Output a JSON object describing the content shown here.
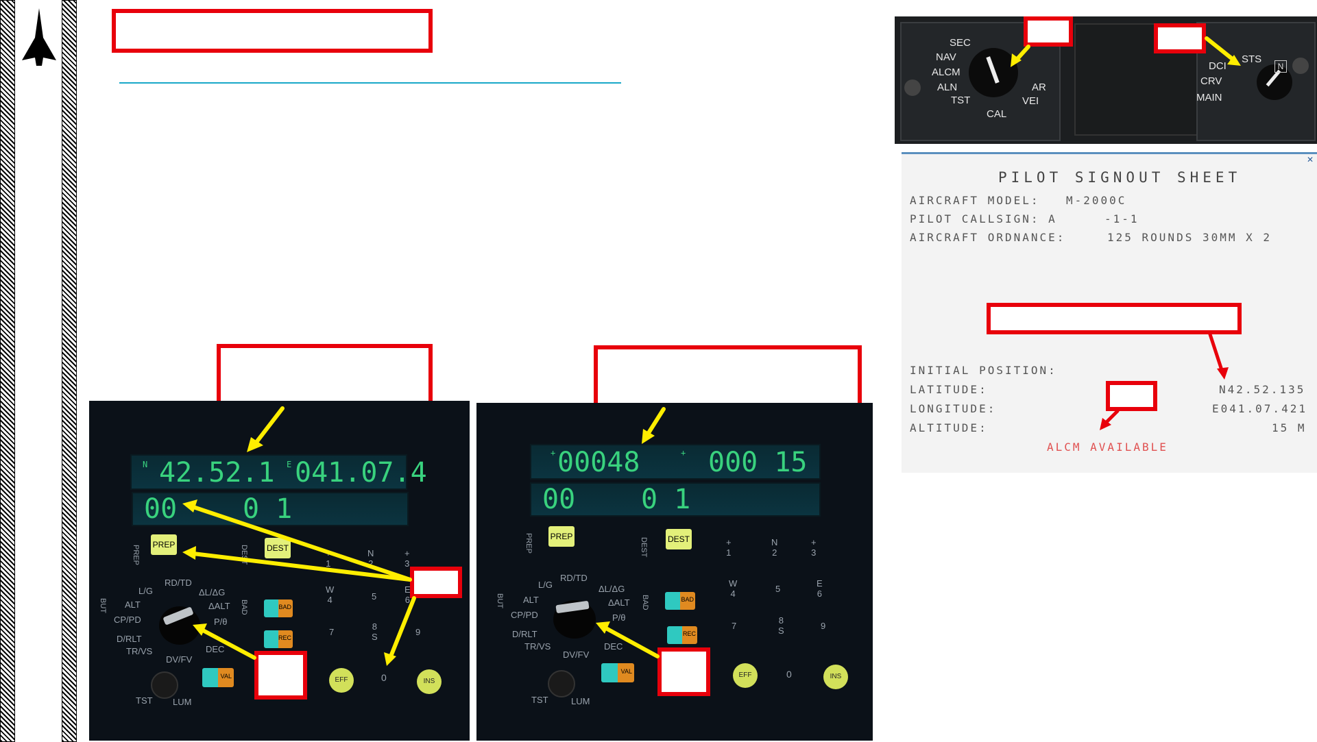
{
  "left_keypad": {
    "lcd_top_left_marker": "N",
    "lcd_top_left": "42.52.1",
    "lcd_top_right_marker": "E",
    "lcd_top_right": "041.07.4",
    "lcd_bottom_left": "00",
    "lcd_bottom_right": "0 1",
    "prep": "PREP",
    "dest": "DEST",
    "prep_vertical": "PREP",
    "dest_vertical": "DEST",
    "bad": "BAD",
    "rec": "REC",
    "val": "VAL",
    "eff": "EFF",
    "ins": "INS",
    "zero": "0",
    "selector_labels": [
      "L/G",
      "ALT",
      "CP/PD",
      "D/RLT",
      "TR/VS",
      "RD/TD",
      "ΔL/ΔG",
      "ΔALT",
      "P/θ",
      "DEC",
      "DV/FV",
      "TST",
      "LUM",
      "BUT",
      "BAD"
    ],
    "numpad": [
      "+\n1",
      "N\n2",
      "+\n3",
      "W\n4",
      "5",
      "E\n6",
      "7",
      "8\nS",
      "9"
    ]
  },
  "right_keypad": {
    "lcd_top_left_marker": "+",
    "lcd_top_left": "00048",
    "lcd_top_right_marker": "+",
    "lcd_top_right": "000 15",
    "lcd_bottom_left": "00",
    "lcd_bottom_right": "0 1",
    "prep": "PREP",
    "dest": "DEST",
    "prep_vertical": "PREP",
    "dest_vertical": "DEST",
    "bad": "BAD",
    "rec": "REC",
    "val": "VAL",
    "eff": "EFF",
    "ins": "INS",
    "zero": "0",
    "selector_labels": [
      "L/G",
      "ALT",
      "CP/PD",
      "D/RLT",
      "TR/VS",
      "RD/TD",
      "ΔL/ΔG",
      "ΔALT",
      "P/θ",
      "DEC",
      "DV/FV",
      "TST",
      "LUM",
      "BUT",
      "BAD"
    ],
    "numpad": [
      "+\n1",
      "N\n2",
      "+\n3",
      "W\n4",
      "5",
      "E\n6",
      "7",
      "8\nS",
      "9"
    ]
  },
  "ins_panel": {
    "left_knob": [
      "SEC",
      "NAV",
      "ALCM",
      "ALN",
      "TST",
      "CAL",
      "VEI",
      "AR"
    ],
    "right_knob": [
      "DCI",
      "CRV",
      "MAIN",
      "STS"
    ],
    "n_indicator": "N"
  },
  "signout_sheet": {
    "close": "✕",
    "title": "PILOT SIGNOUT SHEET",
    "model_label": "AIRCRAFT MODEL:",
    "model_value": "M-2000C",
    "callsign_label": "PILOT CALLSIGN: A",
    "callsign_value": "-1-1",
    "ordnance_label": "AIRCRAFT ORDNANCE:",
    "ordnance_value": "125 ROUNDS 30MM X 2",
    "init_pos": "INITIAL POSITION:",
    "lat_label": "LATITUDE:",
    "lat_value": "N42.52.135",
    "lon_label": "LONGITUDE:",
    "lon_value": "E041.07.421",
    "alt_label": "ALTITUDE:",
    "alt_value": "15 M",
    "alcm": "ALCM AVAILABLE"
  },
  "colors": {
    "callout_red": "#e8000b",
    "arrow_yellow": "#ffee00",
    "divider_blue": "#18a8c8",
    "lcd_green": "#39d27e",
    "alcm_red": "#e05050"
  }
}
